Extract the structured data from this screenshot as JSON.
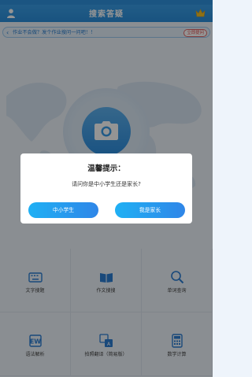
{
  "header": {
    "title": "搜索答疑",
    "user_icon": "user-icon",
    "vip_icon": "crown-icon"
  },
  "notice": {
    "text": "作业不会做？发个作业搜问一问吧！！",
    "button_label": "立即提问"
  },
  "hero": {
    "camera_icon": "camera-icon"
  },
  "tools": [
    {
      "label": "文字搜题",
      "icon": "keyboard-icon"
    },
    {
      "label": "作文搜搜",
      "icon": "book-icon"
    },
    {
      "label": "单词查询",
      "icon": "magnifier-icon"
    },
    {
      "label": "语法解析",
      "icon": "grammar-icon"
    },
    {
      "label": "拍照翻译（简易版）",
      "icon": "translate-icon"
    },
    {
      "label": "数学计算",
      "icon": "calculator-icon"
    }
  ],
  "dialog": {
    "title": "温馨提示：",
    "message": "请问你是中小学生还是家长?",
    "student_button": "中小学生",
    "parent_button": "我是家长"
  },
  "colors": {
    "primary": "#2b8fdc",
    "button_gradient_start": "#1fb0f4",
    "button_gradient_end": "#2f86e8",
    "notice_button": "#e04646"
  }
}
